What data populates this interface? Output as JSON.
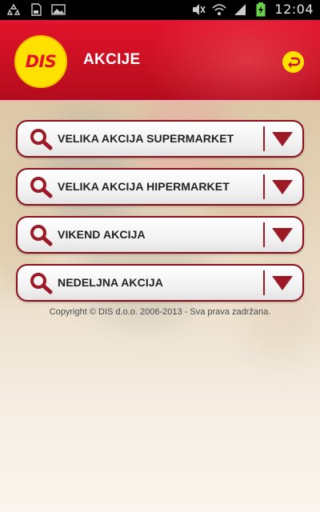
{
  "status_bar": {
    "time": "12:04",
    "icons_left": [
      "recycle-icon",
      "sd-card-icon",
      "image-icon"
    ],
    "icons_right": [
      "mute-icon",
      "wifi-icon",
      "signal-icon",
      "battery-charging-icon"
    ]
  },
  "header": {
    "logo_text": "DIS",
    "title": "AKCIJE",
    "back_icon": "back-arrow-icon"
  },
  "menu": {
    "items": [
      {
        "label": "VELIKA AKCIJA SUPERMARKET"
      },
      {
        "label": "VELIKA AKCIJA HIPERMARKET"
      },
      {
        "label": "VIKEND AKCIJA"
      },
      {
        "label": "NEDELJNA AKCIJA"
      }
    ]
  },
  "footer": {
    "copyright": "Copyright © DIS d.o.o. 2006-2013 - Sva prava zadržana."
  },
  "colors": {
    "brand_red": "#e3132b",
    "brand_yellow": "#ffe100",
    "button_border": "#8c0f1b"
  }
}
